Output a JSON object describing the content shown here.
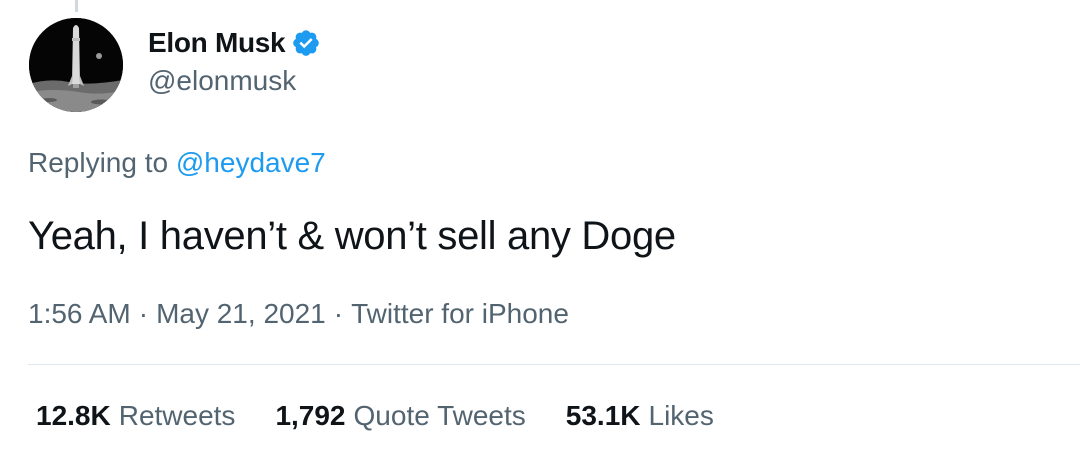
{
  "author": {
    "name": "Elon Musk",
    "handle": "@elonmusk",
    "verified": true
  },
  "reply": {
    "prefix": "Replying to",
    "mention": "@heydave7"
  },
  "tweet": {
    "text": "Yeah, I haven’t & won’t sell any Doge"
  },
  "meta": {
    "time": "1:56 AM",
    "separator": "·",
    "date": "May 21, 2021",
    "source": "Twitter for iPhone"
  },
  "stats": {
    "retweets": {
      "count": "12.8K",
      "label": "Retweets"
    },
    "quotes": {
      "count": "1,792",
      "label": "Quote Tweets"
    },
    "likes": {
      "count": "53.1K",
      "label": "Likes"
    }
  },
  "colors": {
    "accent": "#1d9bf0",
    "secondary_text": "#536471",
    "primary_text": "#0f1419"
  },
  "icons": {
    "verified": "verified-badge-icon",
    "avatar": "starship-on-moon-avatar"
  }
}
